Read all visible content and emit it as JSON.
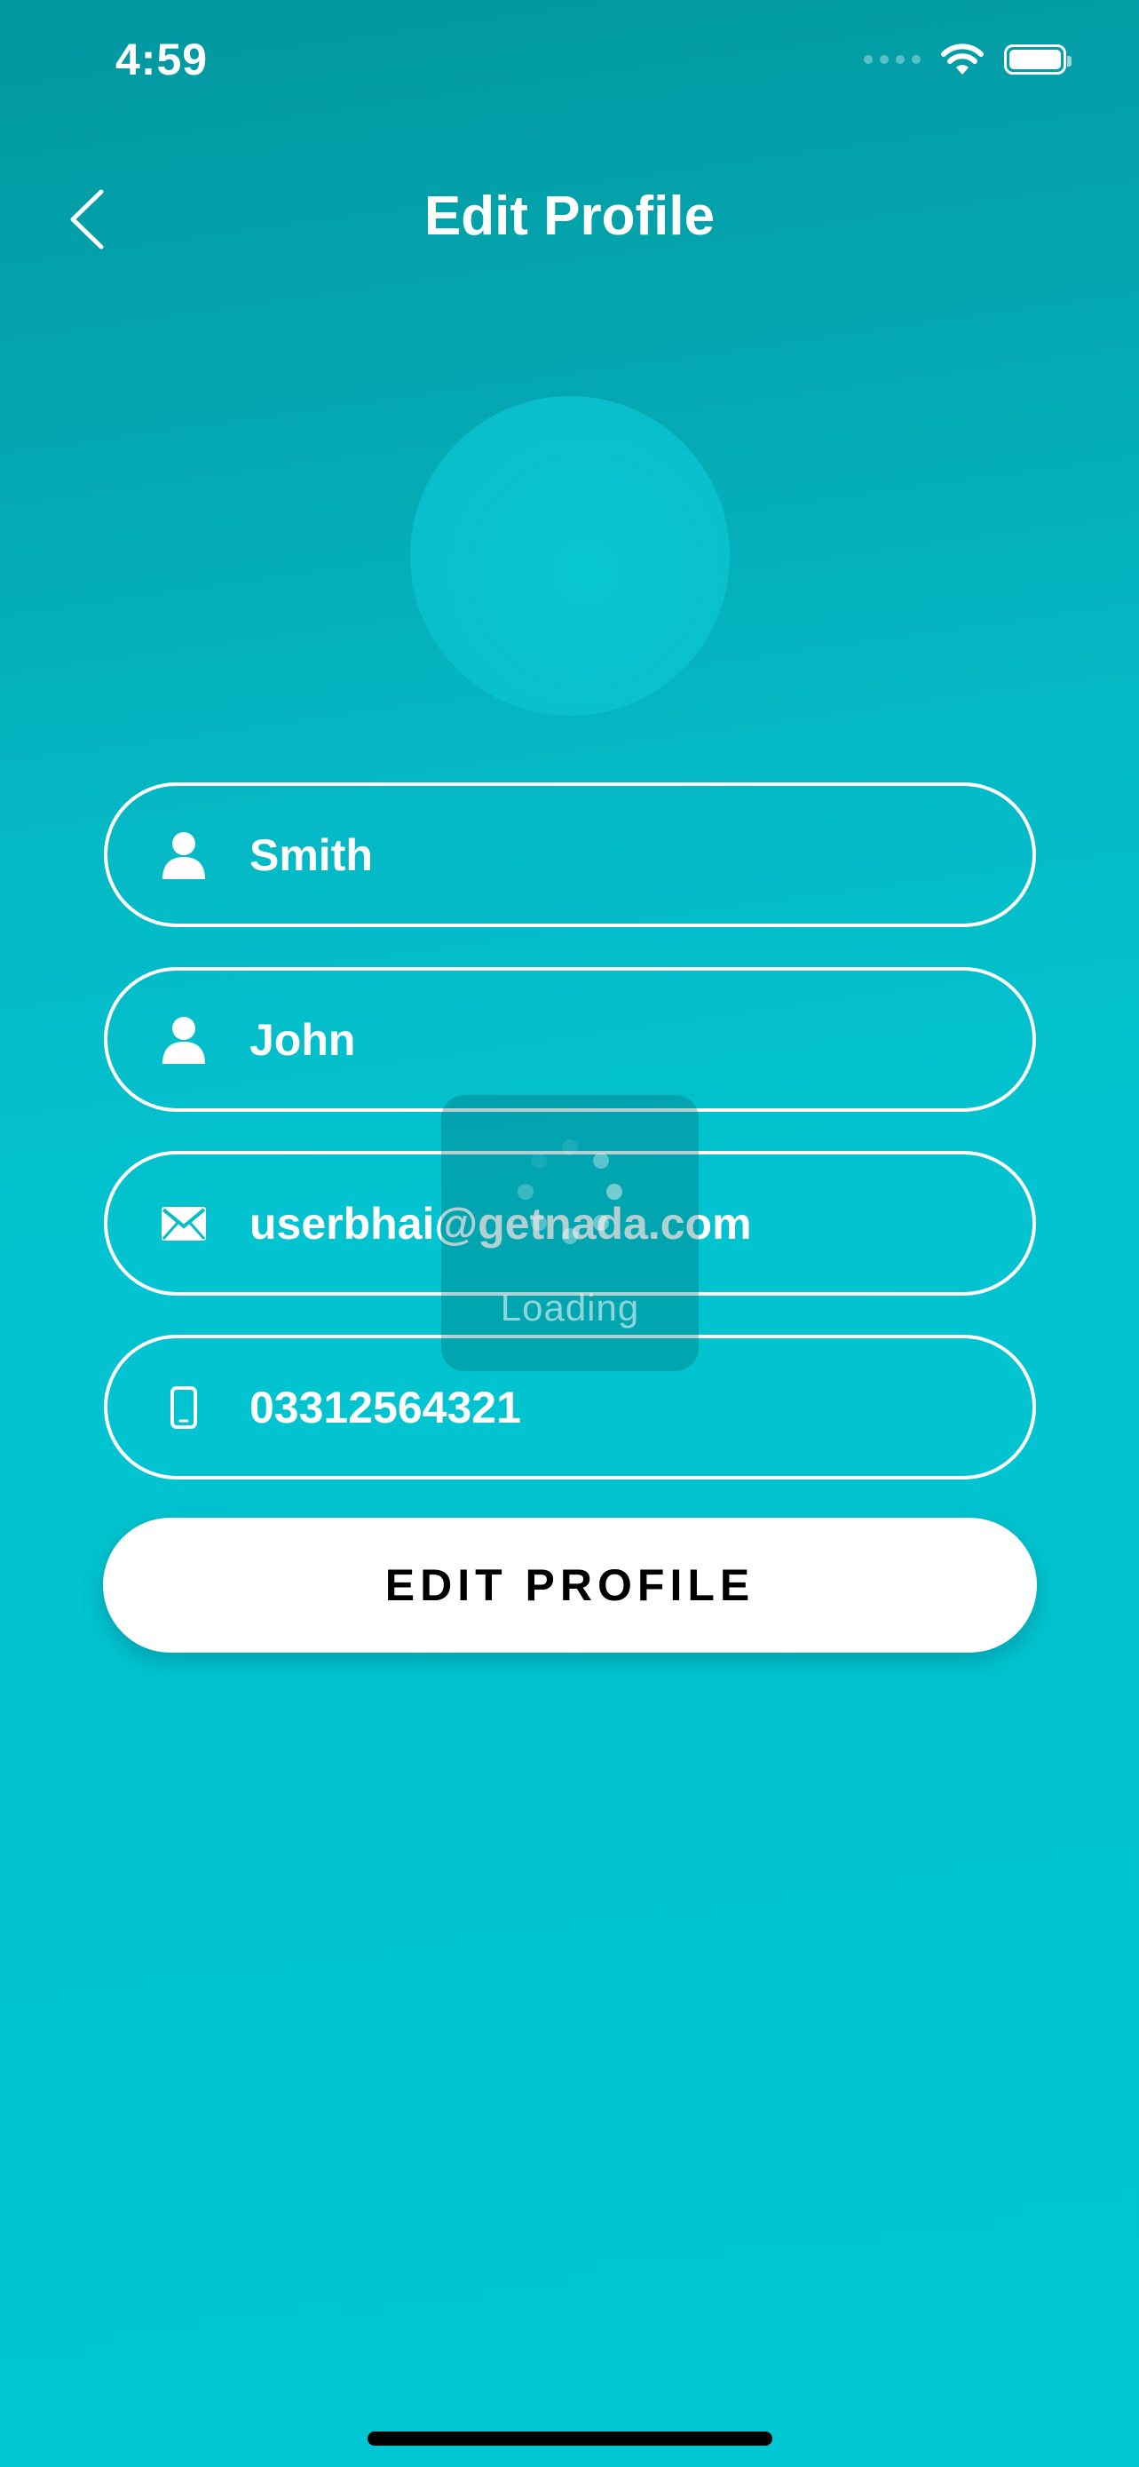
{
  "status_bar": {
    "time": "4:59",
    "icons": [
      "cellular-signal-icon",
      "wifi-icon",
      "battery-icon"
    ]
  },
  "header": {
    "back_icon": "chevron-left-icon",
    "title": "Edit Profile"
  },
  "avatar": {
    "icon": "profile-photo"
  },
  "form": {
    "fields": [
      {
        "name": "last-name",
        "icon": "person-icon",
        "value": "Smith"
      },
      {
        "name": "first-name",
        "icon": "person-icon",
        "value": "John"
      },
      {
        "name": "email",
        "icon": "envelope-icon",
        "value": "userbhai@getnada.com"
      },
      {
        "name": "phone",
        "icon": "mobile-phone-icon",
        "value": "03312564321"
      }
    ],
    "submit_label": "EDIT PROFILE"
  },
  "loading": {
    "label": "Loading"
  },
  "colors": {
    "background_top": "#02979f",
    "background_bottom": "#00c5d2",
    "field_border": "#ffffff",
    "button_bg": "#ffffff",
    "button_text": "#000000"
  }
}
